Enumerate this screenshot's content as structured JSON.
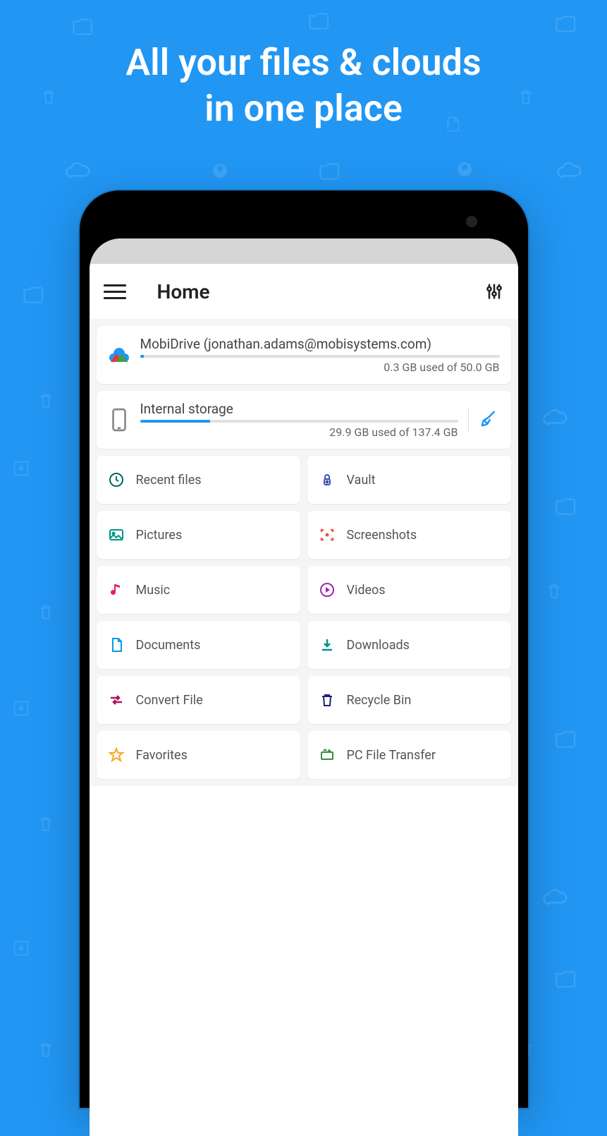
{
  "promo": {
    "line1": "All your files & clouds",
    "line2": "in one place"
  },
  "header": {
    "title": "Home"
  },
  "storage": [
    {
      "title": "MobiDrive (jonathan.adams@mobisystems.com)",
      "subtitle": "0.3 GB used of 50.0 GB",
      "percent": 1
    },
    {
      "title": "Internal storage",
      "subtitle": "29.9 GB used of 137.4 GB",
      "percent": 22
    }
  ],
  "grid": [
    {
      "label": "Recent files"
    },
    {
      "label": "Vault"
    },
    {
      "label": "Pictures"
    },
    {
      "label": "Screenshots"
    },
    {
      "label": "Music"
    },
    {
      "label": "Videos"
    },
    {
      "label": "Documents"
    },
    {
      "label": "Downloads"
    },
    {
      "label": "Convert File"
    },
    {
      "label": "Recycle Bin"
    },
    {
      "label": "Favorites"
    },
    {
      "label": "PC File Transfer"
    }
  ]
}
